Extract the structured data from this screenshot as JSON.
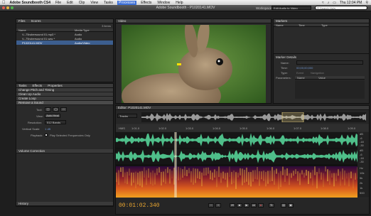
{
  "menubar": {
    "app": "Adobe Soundbooth CS4",
    "items": [
      "File",
      "Edit",
      "Clip",
      "View",
      "Tasks",
      "Processes",
      "Effects",
      "Window",
      "Help"
    ],
    "active": "Processes",
    "clock": "Thu 12:04 PM"
  },
  "titlebar": {
    "title": "Adobe Soundbooth - P1020141.MOV",
    "workspace_label": "Workspace:",
    "workspace_value": "Edit Audio to Video",
    "help_placeholder": "Search Help"
  },
  "files": {
    "tabs": [
      "Files",
      "Scores"
    ],
    "count": "3 items",
    "columns": [
      "Name",
      "Media Type"
    ],
    "rows": [
      {
        "name": "V--75rubersound 01.mp3 *",
        "type": "Audio"
      },
      {
        "name": "V--75rubersound 01.wav *",
        "type": "Audio"
      },
      {
        "name": "P1020141.MOV",
        "type": "Audio/Video"
      }
    ]
  },
  "video": {
    "tab": "Video"
  },
  "markers": {
    "tab": "Markers",
    "columns": [
      "Name",
      "Time",
      "Type"
    ],
    "details": {
      "title": "Marker Details",
      "name_label": "Name:",
      "name_value": "",
      "time_label": "Time:",
      "time_value": "00;00;00;000",
      "type_label": "Type:",
      "type_opt1": "Event",
      "type_opt2": "Navigation",
      "params_label": "Parameters:",
      "param_cols": [
        "Name",
        "Value"
      ]
    }
  },
  "tasks": {
    "tabs": [
      "Tasks",
      "Effects",
      "Properties"
    ],
    "items": [
      "Change Pitch and Timing",
      "Clean Up Audio",
      "Create Loop",
      "Remove a Sound"
    ],
    "tool_label": "Tool:",
    "view_label": "View:",
    "view_value": "Auto Heal",
    "resolution_label": "Resolution:",
    "resolution_value": "512 Bands",
    "vscale_label": "Vertical Scale:",
    "vscale_value": "1 dB",
    "playback_label": "Playback:",
    "playback_value": "Play Selected Frequencies Only",
    "volume": "Volume Correction",
    "history": "History"
  },
  "editor": {
    "tab": "Editor: P1020141.MOV",
    "tracks_label": "Tracks",
    "timecode": "00:01:02.340",
    "ruler": [
      "HMS",
      "1:01.0",
      "1:02.0",
      "1:03.0",
      "1:04.0",
      "1:05.0",
      "1:06.0",
      "1:07.0",
      "1:08.0",
      "1:09.0"
    ],
    "db_labels": [
      "dB",
      "-6",
      "-18",
      "-30",
      "dB",
      "-6",
      "-18",
      "-30",
      "Hz",
      "10k",
      "5k",
      "2k",
      "1k",
      "500"
    ]
  }
}
